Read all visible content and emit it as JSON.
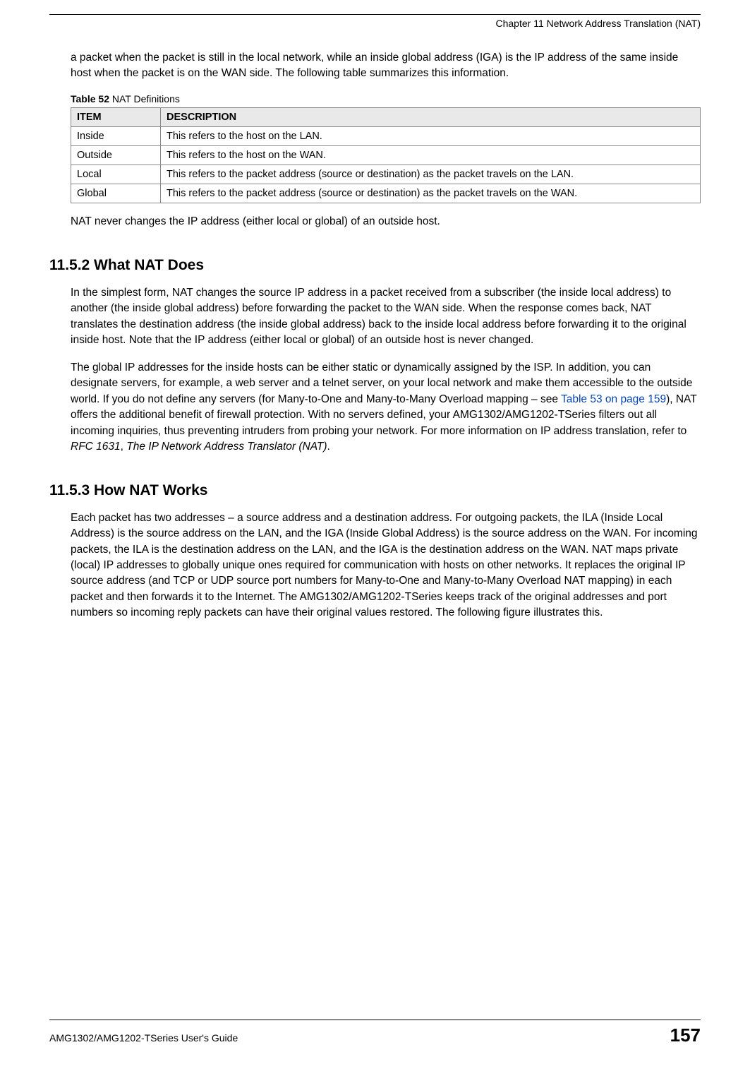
{
  "running_header": "Chapter 11 Network Address Translation (NAT)",
  "intro_paragraph": "a packet when the packet is still in the local network, while an inside global address (IGA) is the IP address of the same inside host when the packet is on the WAN side. The following table summarizes this information.",
  "table": {
    "label_bold": "Table 52",
    "label_rest": "   NAT Definitions",
    "headers": {
      "col1": "ITEM",
      "col2": "DESCRIPTION"
    },
    "rows": [
      {
        "item": "Inside",
        "desc": "This refers to the host on the LAN."
      },
      {
        "item": "Outside",
        "desc": "This refers to the host on the WAN."
      },
      {
        "item": "Local",
        "desc": "This refers to the packet address (source or destination) as the packet travels on the LAN."
      },
      {
        "item": "Global",
        "desc": "This refers to the packet address (source or destination) as the packet travels on the WAN."
      }
    ]
  },
  "paragraph_after_table": "NAT never changes the IP address (either local or global) of an outside host.",
  "section_1152": {
    "heading": "11.5.2  What NAT Does",
    "p1": "In the simplest form, NAT changes the source IP address in a packet received from a subscriber (the inside local address) to another (the inside global address) before forwarding the packet to the WAN side. When the response comes back, NAT translates the destination address (the inside global address) back to the inside local address before forwarding it to the original inside host. Note that the IP address (either local or global) of an outside host is never changed.",
    "p2_before_link": "The global IP addresses for the inside hosts can be either static or dynamically assigned by the ISP. In addition, you can designate servers, for example, a web server and a telnet server, on your local network and make them accessible to the outside world. If you do not define any servers (for Many-to-One and Many-to-Many Overload mapping – see ",
    "p2_link": "Table 53 on page 159",
    "p2_after_link": "), NAT offers the additional benefit of firewall protection. With no servers defined, your AMG1302/AMG1202-TSeries filters out all incoming inquiries, thus preventing intruders from probing your network. For more information on IP address translation, refer to ",
    "p2_italic1": "RFC 1631",
    "p2_sep": ", ",
    "p2_italic2": "The IP Network Address Translator (NAT)",
    "p2_end": "."
  },
  "section_1153": {
    "heading": "11.5.3  How NAT Works",
    "p1": "Each packet has two addresses – a source address and a destination address. For outgoing packets, the ILA (Inside Local Address) is the source address on the LAN, and the IGA (Inside Global Address) is the source address on the WAN. For incoming packets, the ILA is the destination address on the LAN, and the IGA is the destination address on the WAN. NAT maps private (local) IP addresses to globally unique ones required for communication with hosts on other networks. It replaces the original IP source address (and TCP or UDP source port numbers for Many-to-One and Many-to-Many Overload NAT mapping) in each packet and then forwards it to the Internet. The AMG1302/AMG1202-TSeries keeps track of the original addresses and port numbers so incoming reply packets can have their original values restored. The following figure illustrates this."
  },
  "footer": {
    "guide_name": "AMG1302/AMG1202-TSeries User's Guide",
    "page_number": "157"
  }
}
